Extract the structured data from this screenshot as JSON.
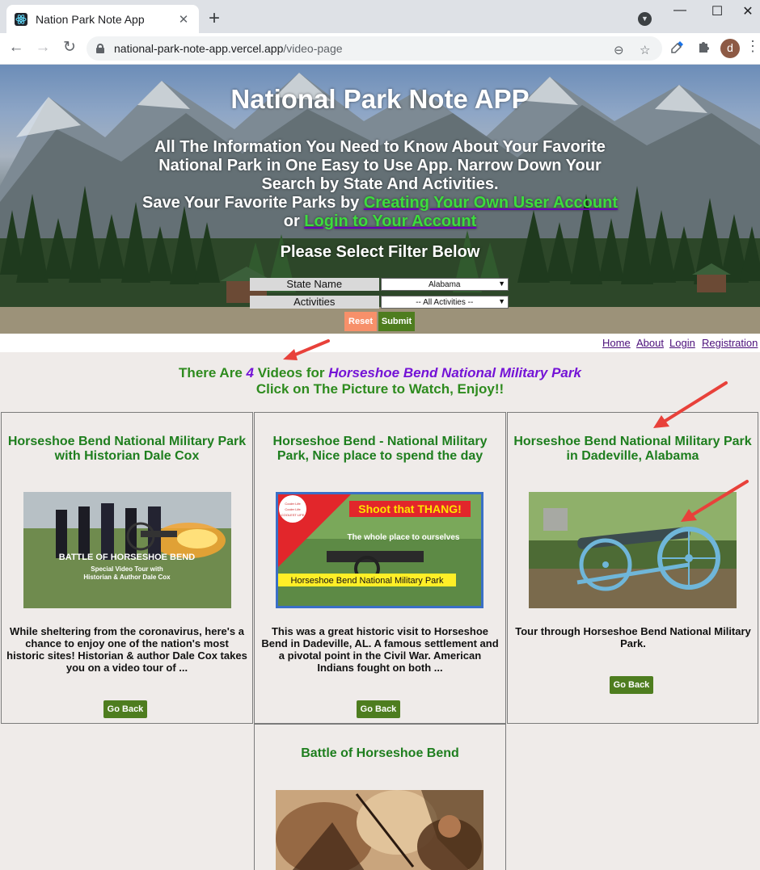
{
  "browser": {
    "tab_title": "Nation Park Note App",
    "tab_close": "✕",
    "new_tab": "+",
    "url_host": "national-park-note-app.vercel.app",
    "url_path": "/video-page",
    "profile_initial": "d",
    "back": "←",
    "forward": "→",
    "reload": "↻",
    "minimize": "—",
    "maximize": "☐",
    "close": "✕",
    "zoom_icon": "⊖",
    "star_icon": "☆",
    "menu": "⋮"
  },
  "hero": {
    "title": "National Park Note APP",
    "intro_text": "All The Information You Need to Know About Your Favorite National Park in One Easy to Use App. Narrow Down Your Search by State And Activities.",
    "save_prefix": "Save Your Favorite Parks by ",
    "create_account_link": "Creating Your Own User Account",
    "or_text": " or ",
    "login_link": "Login to Your Account",
    "filter_title": "Please Select Filter Below",
    "state_label": "State Name",
    "state_value": "Alabama",
    "activities_label": "Activities",
    "activities_value": "-- All Activities --",
    "reset_label": "Reset",
    "submit_label": "Submit"
  },
  "nav": {
    "home": "Home",
    "about": "About",
    "login": "Login",
    "registration": "Registration"
  },
  "summary": {
    "line1_prefix": "There Are ",
    "count": "4",
    "line1_mid": " Videos for ",
    "park": "Horseshoe Bend National Military Park",
    "line2": "Click on The Picture to Watch, Enjoy!!"
  },
  "videos": [
    {
      "title": "Horseshoe Bend National Military Park with Historian Dale Cox",
      "thumb_text1": "BATTLE OF HORSESHOE BEND",
      "thumb_text2": "Special Video Tour with",
      "thumb_text3": "Historian & Author Dale Cox",
      "description": "While sheltering from the coronavirus, here's a chance to enjoy one of the nation's most historic sites! Historian & author Dale Cox takes you on a video tour of ...",
      "button": "Go Back"
    },
    {
      "title": "Horseshoe Bend - National Military Park, Nice place to spend the day",
      "thumb_badge1": "Cooler Life",
      "thumb_badge2": "Cooler Life",
      "thumb_badge3": "COOLEST LIFE",
      "thumb_text1": "Shoot that THANG!",
      "thumb_text2": "The whole place to ourselves",
      "thumb_text3": "Horseshoe Bend National Military Park",
      "description": "This was a great historic visit to Horseshoe Bend in Dadeville, AL. A famous settlement and a pivotal point in the Civil War. American Indians fought on both ...",
      "button": "Go Back"
    },
    {
      "title": "Horseshoe Bend National Military Park in Dadeville, Alabama",
      "description": "Tour through Horseshoe Bend National Military Park.",
      "button": "Go Back"
    },
    {
      "title": "Battle of Horseshoe Bend"
    }
  ],
  "colors": {
    "accent_green": "#1e7e1e",
    "link_green": "#3ddc3d",
    "purple": "#7413d6",
    "button_green": "#4e7d1f",
    "reset_orange": "#f7906a",
    "arrow_red": "#e8413a"
  }
}
